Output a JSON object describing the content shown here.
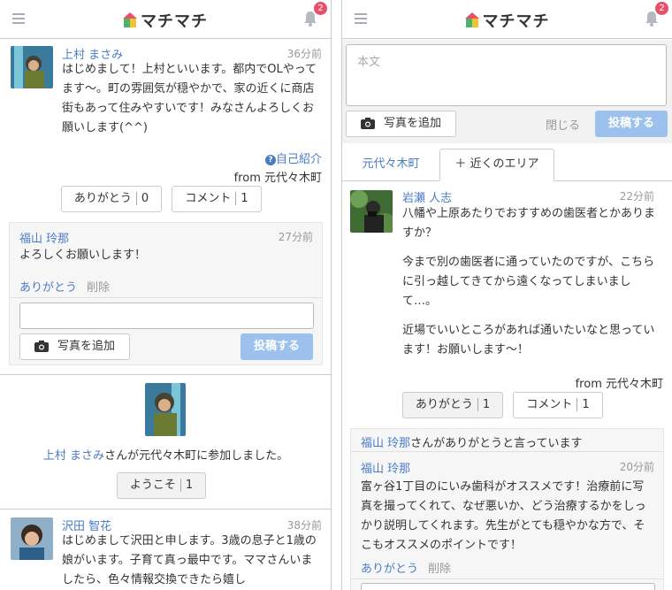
{
  "header": {
    "app_name": "マチマチ",
    "notif_count": "2"
  },
  "left": {
    "post1": {
      "name": "上村 まさみ",
      "time": "36分前",
      "body": "はじめまして！上村といいます。都内でOLやってます〜。町の雰囲気が穏やかで、家の近くに商店街もあって住みやすいです！みなさんよろしくお願いします(^^)",
      "tag": "自己紹介",
      "from": "from 元代々木町",
      "thanks_label": "ありがとう",
      "thanks_count": "0",
      "comment_label": "コメント",
      "comment_count": "1"
    },
    "comment1": {
      "name": "福山 玲那",
      "time": "27分前",
      "body": "よろしくお願いします！",
      "thanks": "ありがとう",
      "delete": "削除"
    },
    "reply": {
      "photo_label": "写真を追加",
      "submit_label": "投稿する"
    },
    "join": {
      "name": "上村 まさみ",
      "text": "さんが元代々木町に参加しました。",
      "welcome_label": "ようこそ",
      "welcome_count": "1"
    },
    "post2": {
      "name": "沢田 智花",
      "time": "38分前",
      "body": "はじめまして沢田と申します。3歳の息子と1歳の娘がいます。子育て真っ最中です。ママさんいましたら、色々情報交換できたら嬉し"
    }
  },
  "right": {
    "compose": {
      "placeholder": "本文",
      "photo_label": "写真を追加",
      "close_label": "閉じる",
      "submit_label": "投稿する"
    },
    "tabs": {
      "tab1": "元代々木町",
      "tab2": "＋ 近くのエリア"
    },
    "post": {
      "name": "岩瀬 人志",
      "time": "22分前",
      "body1": "八幡や上原あたりでおすすめの歯医者とかありますか？",
      "body2": "今まで別の歯医者に通っていたのですが、こちらに引っ越してきてから遠くなってしまいまして…。",
      "body3": "近場でいいところがあれば通いたいなと思っています！お願いします〜！",
      "from": "from 元代々木町",
      "thanks_label": "ありがとう",
      "thanks_count": "1",
      "comment_label": "コメント",
      "comment_count": "1"
    },
    "thanked": {
      "name": "福山 玲那",
      "text": "さんがありがとうと言っています"
    },
    "comment": {
      "name": "福山 玲那",
      "time": "20分前",
      "body": "富ヶ谷1丁目のにいみ歯科がオススメです！治療前に写真を撮ってくれて、なぜ悪いか、どう治療するかをしっかり説明してくれます。先生がとても穏やかな方で、そこもオススメのポイントです！",
      "thanks": "ありがとう",
      "delete": "削除"
    }
  },
  "colors": {
    "accent": "#4a7cc4",
    "submit": "#9cc1ec",
    "badge": "#e8506a",
    "logo_green": "#4db36a",
    "logo_red": "#e8506a",
    "logo_yellow": "#f2c331"
  }
}
